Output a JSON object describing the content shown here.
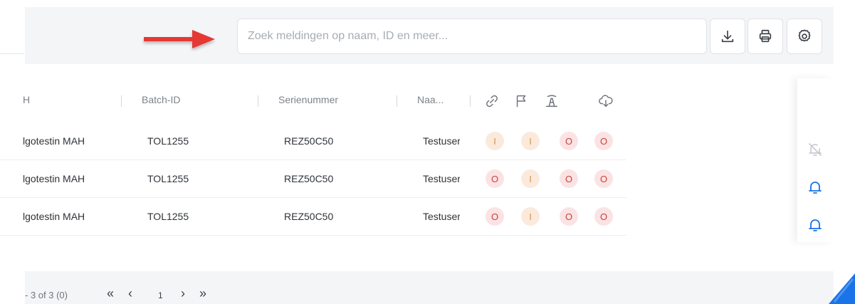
{
  "search": {
    "placeholder": "Zoek meldingen op naam, ID en meer..."
  },
  "toolbar": {
    "buttons": [
      {
        "name": "download-icon"
      },
      {
        "name": "print-icon"
      },
      {
        "name": "settings-icon"
      }
    ]
  },
  "table": {
    "columns": [
      "H",
      "Batch-ID",
      "Serienummer",
      "Naa..."
    ],
    "icon_columns": [
      "link-icon",
      "flag-icon",
      "tower-icon",
      "cloud-download-icon"
    ],
    "rows": [
      {
        "mah": "lgotestin MAH",
        "batch_id": "TOL1255",
        "serial": "REZ50C50",
        "name": "Testuser",
        "status": [
          "I",
          "I",
          "O",
          "O"
        ]
      },
      {
        "mah": "lgotestin MAH",
        "batch_id": "TOL1255",
        "serial": "REZ50C50",
        "name": "Testuser",
        "status": [
          "O",
          "I",
          "O",
          "O"
        ]
      },
      {
        "mah": "lgotestin MAH",
        "batch_id": "TOL1255",
        "serial": "REZ50C50",
        "name": "Testuser",
        "status": [
          "O",
          "I",
          "O",
          "O"
        ]
      }
    ]
  },
  "right_column": {
    "icons": [
      "bell-off-icon",
      "bell-icon",
      "bell-icon"
    ]
  },
  "pagination": {
    "summary": "- 3 of 3 (0)",
    "first": "«",
    "prev": "‹",
    "page": "1",
    "next": "›",
    "last": "»"
  },
  "colors": {
    "accent": "#1a73e8",
    "arrow": "#e53935",
    "pill_red": "#fbe3e3",
    "pill_amber": "#fbeadc"
  }
}
